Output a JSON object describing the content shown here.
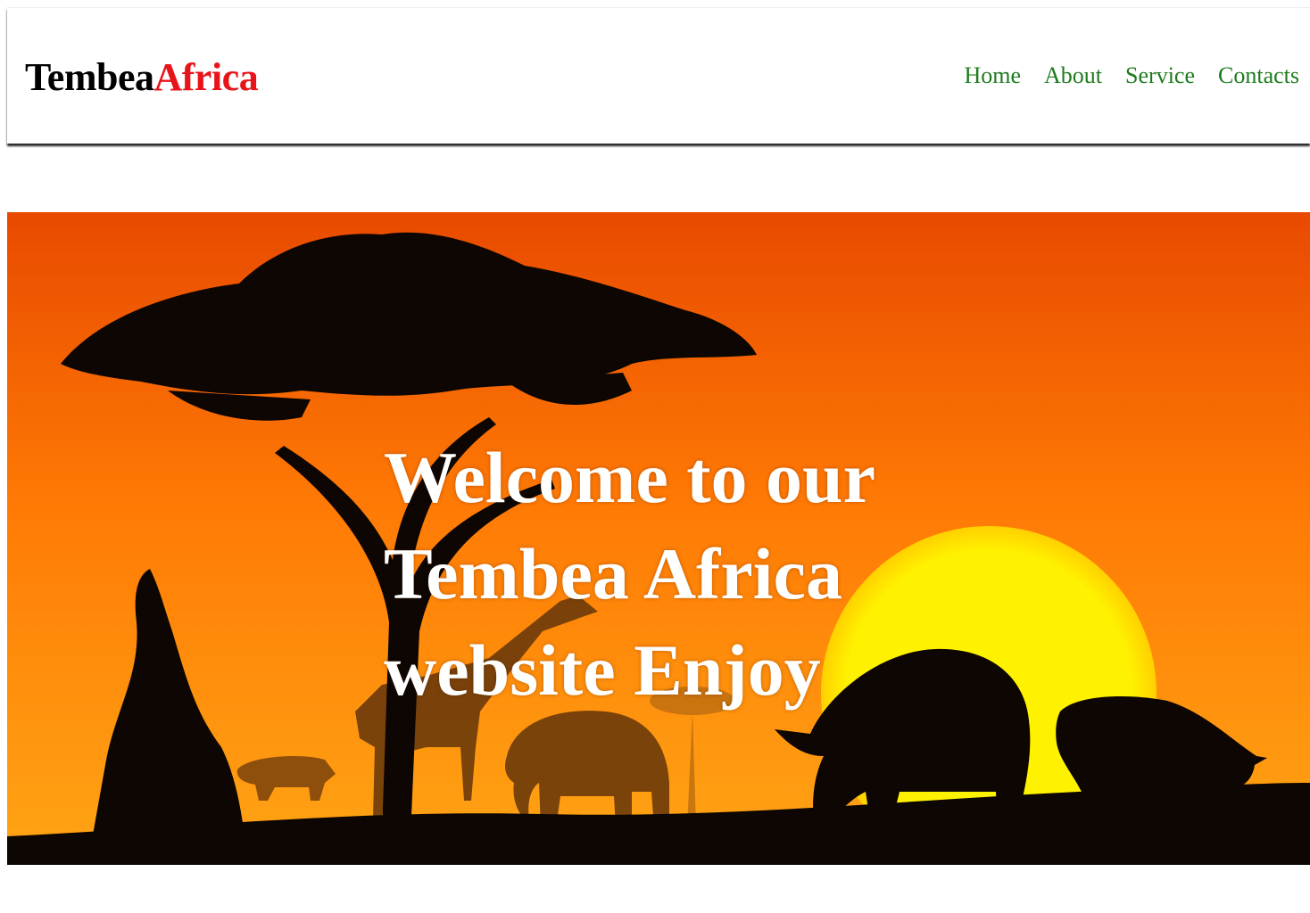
{
  "header": {
    "logo_part1": "Tembea",
    "logo_part2": "Africa",
    "nav": {
      "home": "Home",
      "about": "About",
      "service": "Service",
      "contacts": "Contacts"
    }
  },
  "hero": {
    "line1": "Welcome to our",
    "line2": "Tembea Africa",
    "line3": "website Enjoy"
  },
  "colors": {
    "nav_link": "#1e7b1e",
    "logo_accent": "#e8141b",
    "sky_top": "#e84a00",
    "sky_bottom": "#ffa010",
    "sun": "#ffee00"
  }
}
